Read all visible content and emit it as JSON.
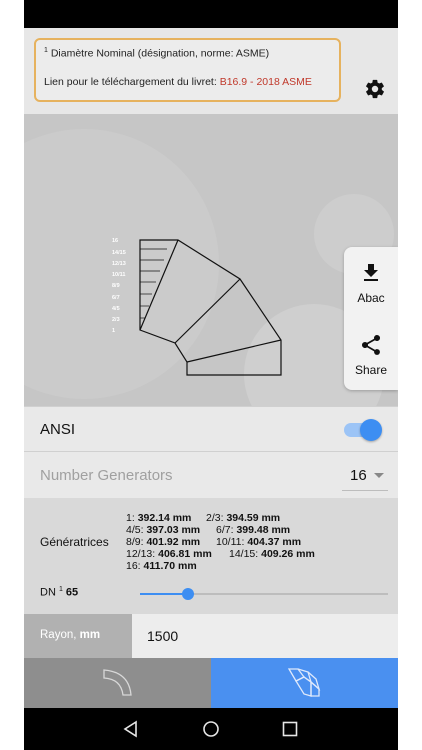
{
  "header": {
    "info_footnote": "1",
    "info_line1": "Diamètre Nominal (désignation, norme: ASME)",
    "info_line2_prefix": "Lien pour le téléchargement du livret: ",
    "info_link": "B16.9 - 2018 ASME",
    "settings_icon": "gear-icon"
  },
  "diagram": {
    "segment_labels": [
      "16",
      "14/15",
      "12/13",
      "10/11",
      "8/9",
      "6/7",
      "4/5",
      "2/3",
      "1"
    ]
  },
  "actions": {
    "abac_label": "Abac",
    "abac_icon": "download-icon",
    "share_label": "Share",
    "share_icon": "share-icon"
  },
  "ansi": {
    "label": "ANSI",
    "toggle_on": true
  },
  "generators": {
    "label": "Number Generators",
    "value": "16"
  },
  "generatrices": {
    "label": "Génératrices",
    "items": [
      {
        "key": "1:",
        "value": "392.14 mm"
      },
      {
        "key": "2/3:",
        "value": "394.59 mm"
      },
      {
        "key": "4/5:",
        "value": "397.03 mm"
      },
      {
        "key": "6/7:",
        "value": "399.48 mm"
      },
      {
        "key": "8/9:",
        "value": "401.92 mm"
      },
      {
        "key": "10/11:",
        "value": "404.37 mm"
      },
      {
        "key": "12/13:",
        "value": "406.81 mm"
      },
      {
        "key": "14/15:",
        "value": "409.26 mm"
      },
      {
        "key": "16:",
        "value": "411.70 mm"
      }
    ]
  },
  "dn": {
    "label": "DN",
    "footnote": "1",
    "value": "65"
  },
  "rayon": {
    "label": "Rayon,",
    "unit": "mm",
    "value": "1500"
  },
  "tabs": {
    "left_icon": "elbow-icon",
    "right_icon": "segmented-elbow-icon",
    "active": "right"
  },
  "nav": {
    "back_icon": "back-icon",
    "home_icon": "home-icon",
    "recents_icon": "recents-icon"
  },
  "colors": {
    "accent": "#3d8ef2",
    "info_border": "#e6b25e",
    "link": "#c0392b",
    "tab_active": "#4a90f0",
    "tab_inactive": "#8e8e8e"
  }
}
